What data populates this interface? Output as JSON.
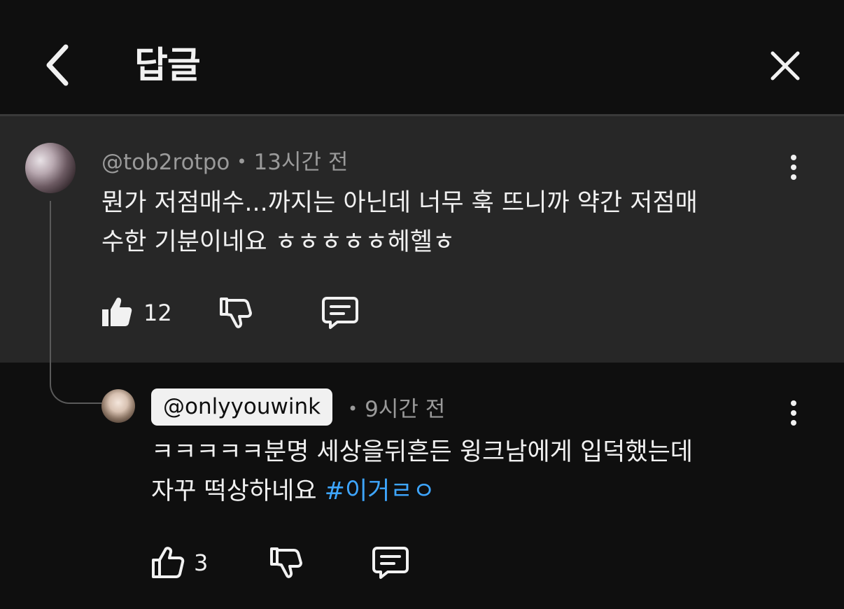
{
  "header": {
    "title": "답글"
  },
  "parent_comment": {
    "author": "@tob2rotpo",
    "time": "13시간 전",
    "text_line1": "뭔가 저점매수...까지는 아닌데 너무 훅 뜨니까 약간 저점매",
    "text_line2": "수한 기분이네요 ㅎㅎㅎㅎㅎ헤헬ㅎ",
    "likes": "12"
  },
  "reply": {
    "author": "@onlyyouwink",
    "time": "9시간 전",
    "text_line1": "ㅋㅋㅋㅋㅋ분명 세상을뒤흔든 윙크남에게 입덕했는데",
    "text_line2_plain": "자꾸 떡상하네요 ",
    "hashtag": "#이거ㄹㅇ",
    "likes": "3"
  },
  "icons": {
    "back": "chevron-left-icon",
    "close": "close-icon",
    "more": "more-vertical-icon",
    "like": "thumbs-up-icon",
    "dislike": "thumbs-down-icon",
    "reply": "comment-icon"
  },
  "colors": {
    "background": "#0f0f0f",
    "highlight": "#272727",
    "text": "#f1f1f1",
    "meta": "#9a9a9a",
    "hashtag": "#3ea6ff"
  }
}
